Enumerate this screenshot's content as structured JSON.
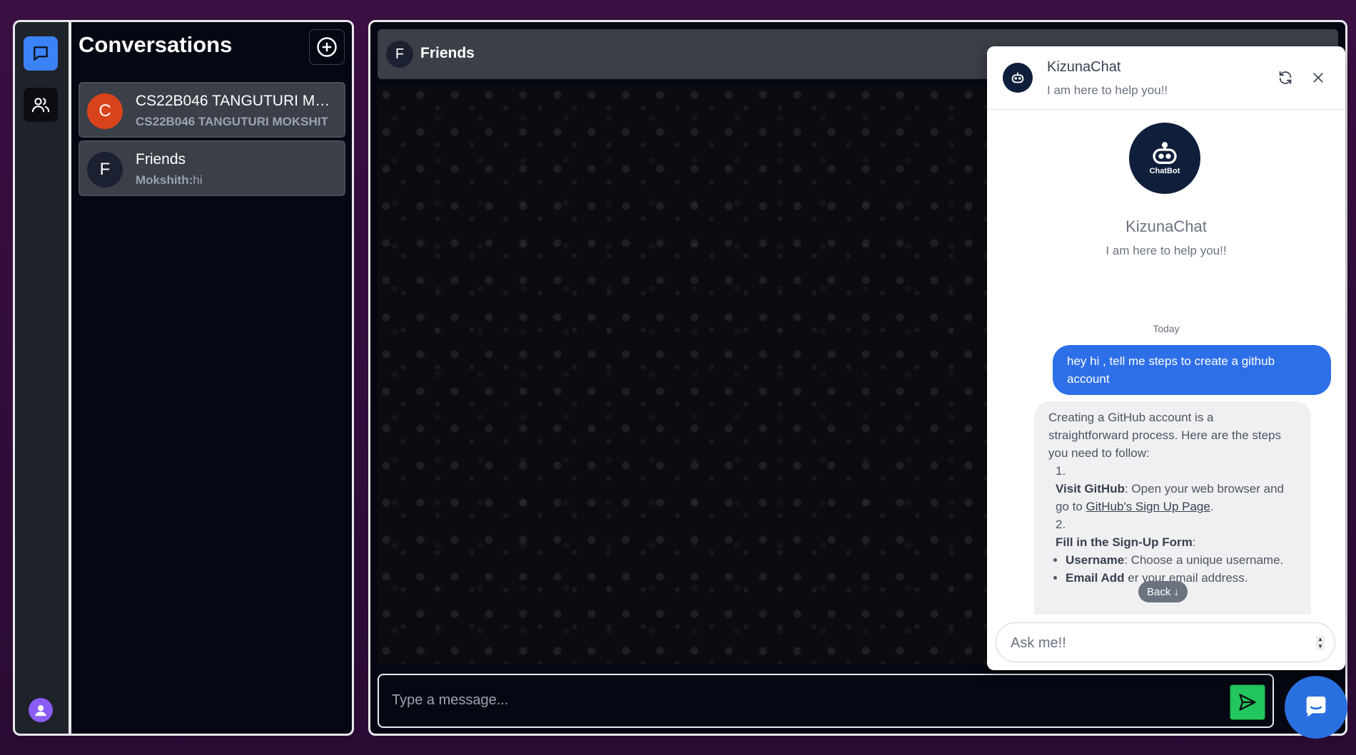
{
  "sidebar": {
    "icons": [
      "chat-icon",
      "users-icon",
      "profile-avatar-icon"
    ]
  },
  "conversations": {
    "title": "Conversations",
    "items": [
      {
        "avatar_letter": "C",
        "name": "CS22B046 TANGUTURI MO...",
        "sender": "CS22B046 TANGUTURI MOKSHIT",
        "message": "",
        "avatar_color": "#d9431c"
      },
      {
        "avatar_letter": "F",
        "name": "Friends",
        "sender": "Mokshith:",
        "message": "hi",
        "avatar_color": "#1b2130"
      }
    ]
  },
  "chat": {
    "avatar_letter": "F",
    "title": "Friends",
    "input_placeholder": "Type a message..."
  },
  "chatbot": {
    "name": "KizunaChat",
    "tagline": "I am here to help you!!",
    "logo_label": "ChatBot",
    "day_label": "Today",
    "user_message": "hey hi , tell me steps to create a github account",
    "reply": {
      "intro": "Creating a GitHub account is a straightforward process. Here are the steps you need to follow:",
      "step1_num": "1.",
      "step1_title": "Visit GitHub",
      "step1_text_a": ": Open your web browser and go to ",
      "step1_link": "GitHub's Sign Up Page",
      "step1_text_b": ".",
      "step2_num": "2.",
      "step2_title": "Fill in the Sign-Up Form",
      "step2_colon": ":",
      "bullet1_title": "Username",
      "bullet1_text": ": Choose a unique username.",
      "bullet2_title": "Email Add",
      "bullet2_text": "er your email address."
    },
    "back_label": "Back ↓",
    "ask_placeholder": "Ask me!!"
  },
  "colors": {
    "accent_blue": "#3b82f6",
    "send_green": "#22c55e",
    "user_bubble": "#2d6fe8"
  }
}
